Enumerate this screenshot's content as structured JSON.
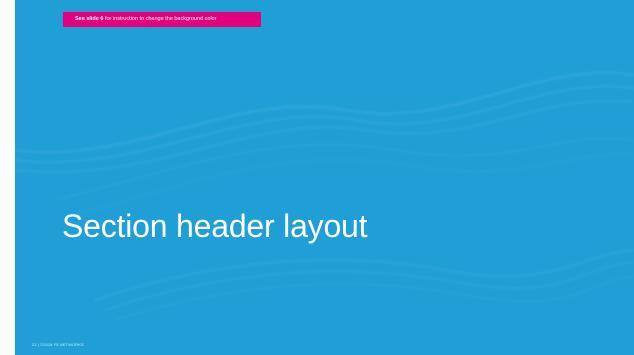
{
  "slide": {
    "background_color": "#1f9fd6",
    "note": {
      "bold": "See slide 6",
      "rest": " for instruction to change the background color",
      "color": "#e4007c"
    },
    "title": "Section header layout",
    "footer": "21 | ©2018 F5 NETWORKS"
  }
}
